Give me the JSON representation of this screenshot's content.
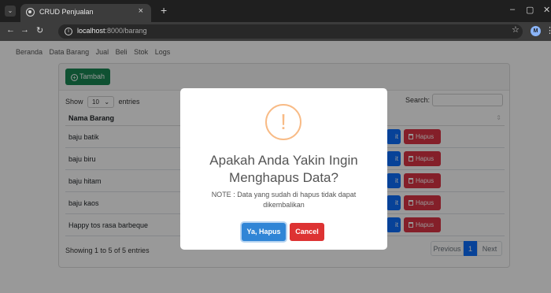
{
  "browser": {
    "tab_title": "CRUD Penjualan",
    "tab_close": "×",
    "new_tab": "+",
    "url_host": "localhost",
    "url_rest": ":8000/barang",
    "minimize": "–",
    "restore": "▢",
    "close": "✕",
    "profile_initial": "M"
  },
  "navbar": {
    "items": [
      "Beranda",
      "Data Barang",
      "Jual",
      "Beli",
      "Stok",
      "Logs"
    ]
  },
  "card": {
    "add_label": "Tambah",
    "show_label": "Show",
    "entries_value": "10",
    "entries_label": "entries",
    "search_label": "Search:",
    "column_name": "Nama Barang",
    "rows": [
      {
        "name": "baju batik"
      },
      {
        "name": "baju biru"
      },
      {
        "name": "baju hitam"
      },
      {
        "name": "baju kaos"
      },
      {
        "name": "Happy tos rasa barbeque"
      }
    ],
    "edit_label": "it",
    "delete_label": "Hapus",
    "info_text": "Showing 1 to 5 of 5 entries",
    "pager": {
      "previous": "Previous",
      "current": "1",
      "next": "Next"
    }
  },
  "modal": {
    "icon": "!",
    "title": "Apakah Anda Yakin Ingin Menghapus Data?",
    "text": "NOTE : Data yang sudah di hapus tidak dapat dikembalikan",
    "confirm_label": "Ya, Hapus",
    "cancel_label": "Cancel"
  },
  "colors": {
    "add_button": "#198754",
    "edit_button": "#0d6efd",
    "delete_button": "#dc3545",
    "confirm_button": "#3085d6",
    "cancel_button": "#dd3333",
    "warning_icon": "#f8bb86"
  }
}
